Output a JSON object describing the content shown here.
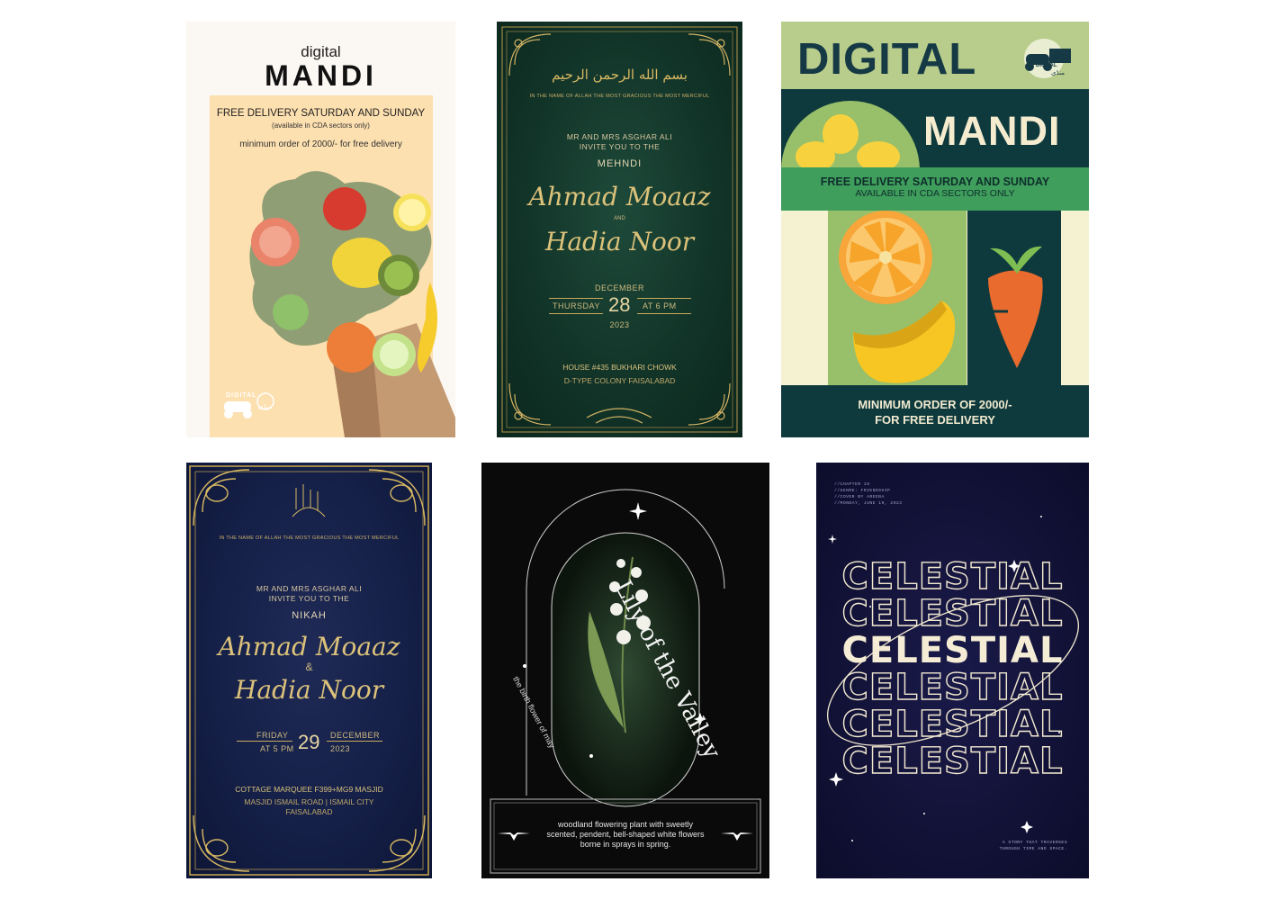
{
  "posters": {
    "mandi_watercolor": {
      "brand_small": "digital",
      "brand_big": "MANDI",
      "line1": "FREE DELIVERY SATURDAY AND SUNDAY",
      "line2": "(available in CDA sectors only)",
      "line3": "minimum order of 2000/- for free delivery",
      "logo_text": "DIGITAL",
      "logo_urdu": "منڈی"
    },
    "mehndi_invite": {
      "arabic": "بسم الله الرحمن الرحيم",
      "subtitle": "IN THE NAME OF ALLAH THE MOST GRACIOUS THE MOST MERCIFUL",
      "hosts": "MR AND MRS ASGHAR ALI",
      "invite": "INVITE YOU TO THE",
      "event": "MEHNDI",
      "groom": "Ahmad Moaaz",
      "and": "AND",
      "bride": "Hadia Noor",
      "month": "DECEMBER",
      "weekday": "THURSDAY",
      "day": "28",
      "time": "AT 6 PM",
      "year": "2023",
      "address1": "HOUSE #435 BUKHARI CHOWK",
      "address2": "D-TYPE COLONY FAISALABAD"
    },
    "mandi_poster": {
      "digital": "DIGITAL",
      "mandi": "MANDI",
      "logo_text": "DIGITAL",
      "logo_urdu": "منڈی",
      "banner1": "FREE DELIVERY SATURDAY AND SUNDAY",
      "banner2": "AVAILABLE IN CDA SECTORS ONLY",
      "footer1": "MINIMUM ORDER OF 2000/-",
      "footer2": "FOR FREE DELIVERY"
    },
    "nikah_invite": {
      "subtitle": "IN THE NAME OF ALLAH THE MOST GRACIOUS THE MOST MERCIFUL",
      "hosts": "MR AND MRS ASGHAR ALI",
      "invite": "INVITE YOU TO THE",
      "event": "NIKAH",
      "groom": "Ahmad Moaaz",
      "amp": "&",
      "bride": "Hadia Noor",
      "weekday": "FRIDAY",
      "time": "AT 5 PM",
      "day": "29",
      "month": "DECEMBER",
      "year": "2023",
      "venue": "COTTAGE MARQUEE F399+MG9 MASJID",
      "address1": "MASJID ISMAIL ROAD | ISMAIL CITY",
      "address2": "FAISALABAD"
    },
    "lily": {
      "title": "Lily of the Valley",
      "subtitle": "the birth flower of may",
      "desc1": "woodland flowering plant with sweetly",
      "desc2": "scented, pendent, bell-shaped white flowers",
      "desc3": "borne in sprays in spring."
    },
    "celestial": {
      "meta": [
        "//CHAPTER 19",
        "//GENRE: FRIENDSHIP",
        "//COVER BY AREEBA",
        "//MONDAY, JUNE 19, 2023"
      ],
      "word": "CELESTIAL",
      "story1": "A STORY THAT TRAVERSES",
      "story2": "THROUGH TIME AND SPACE."
    }
  },
  "colors": {
    "mandi_cream": "#fbf7f2",
    "mandi_peach": "#fde0b0",
    "mehndi_green": "#123428",
    "gold": "#d8b862",
    "nikah_navy": "#152048",
    "poster_teal": "#0f3a3d",
    "poster_lime": "#b8cc8b",
    "poster_green": "#3f9e5c",
    "lily_black": "#0a0a0a",
    "celestial_navy": "#121237"
  },
  "icons": [
    "fruit-bag-illustration",
    "scooter-logo-icon",
    "ornamental-frame",
    "lily-flower-illustration",
    "sparkle-star-icon",
    "orbit-ring"
  ]
}
